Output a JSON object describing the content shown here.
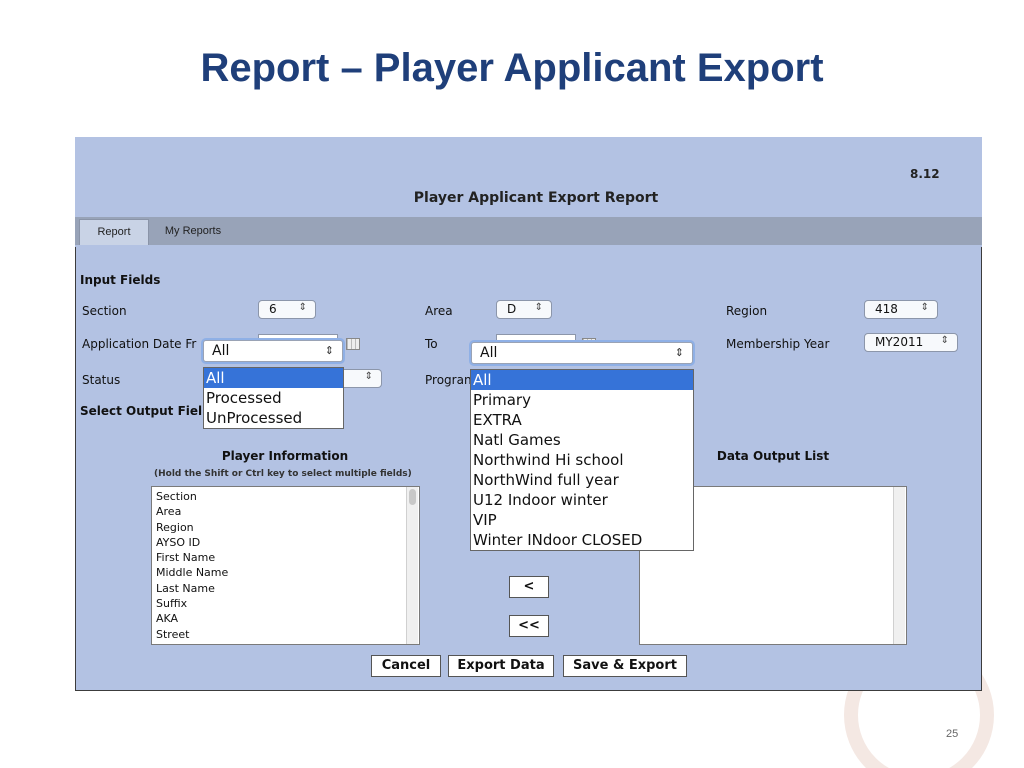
{
  "slide": {
    "title": "Report – Player Applicant Export",
    "page_number": "25"
  },
  "app": {
    "version": "8.12",
    "title": "Player Applicant Export Report",
    "tabs": [
      {
        "label": "Report"
      },
      {
        "label": "My Reports"
      }
    ]
  },
  "input_fields": {
    "heading": "Input Fields",
    "section": {
      "label": "Section",
      "value": "6"
    },
    "area": {
      "label": "Area",
      "value": "D"
    },
    "region": {
      "label": "Region",
      "value": "418"
    },
    "application_date_from": {
      "label": "Application Date Fr"
    },
    "to": {
      "label": "To"
    },
    "membership_year": {
      "label": "Membership Year",
      "value": "MY2011"
    },
    "status": {
      "label": "Status"
    },
    "program": {
      "label": "Progran"
    }
  },
  "select_output": {
    "heading": "Select Output Fiel",
    "player_info_title": "Player Information",
    "hint": "(Hold the Shift or Ctrl key to select multiple fields)",
    "fields": [
      "Section",
      "Area",
      "Region",
      "AYSO ID",
      "First Name",
      "Middle Name",
      "Last Name",
      "Suffix",
      "AKA",
      "Street"
    ],
    "data_output_title": "Data Output List",
    "remove_one_label": "<",
    "remove_all_label": "<<"
  },
  "status_dropdown": {
    "selected": "All",
    "options": [
      "All",
      "Processed",
      "UnProcessed"
    ]
  },
  "program_dropdown": {
    "selected": "All",
    "options": [
      "All",
      "Primary",
      "EXTRA",
      "Natl Games",
      "Northwind Hi school",
      "NorthWind full year",
      "U12 Indoor winter",
      "VIP",
      "Winter INdoor CLOSED"
    ]
  },
  "actions": {
    "cancel": "Cancel",
    "export": "Export Data",
    "save_export": "Save & Export"
  },
  "icons": {
    "select_arrow": "⇕",
    "calendar": "calendar-icon"
  }
}
